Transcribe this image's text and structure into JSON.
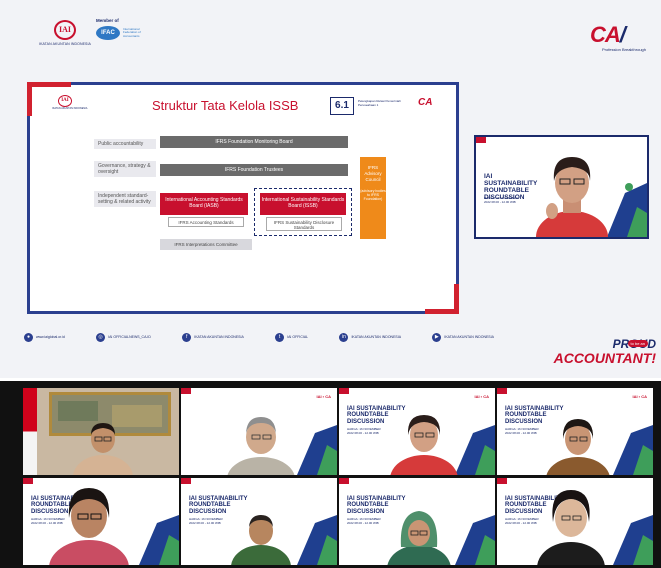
{
  "header": {
    "org_logo_text": "IKATAN AKUNTAN INDONESIA",
    "member_of": "Member of",
    "ifac": "IFAC",
    "ifac_sub": "International Federation of Accountants",
    "ca_logo": "CA",
    "ca_sub": "Profession Breakthrough"
  },
  "slide": {
    "title": "Struktur Tata Kelola ISSB",
    "number": "6.1",
    "number_caption": "Pelengkapan Relasi Pemerintah Peruseahaan 1",
    "ca_mark": "CA",
    "rows": [
      {
        "label": "Public accountability"
      },
      {
        "label": "Governance, strategy & oversight"
      },
      {
        "label": "Independent standard-setting & related activity"
      }
    ],
    "monitoring_board": "IFRS Foundation Monitoring Board",
    "trustees": "IFRS Foundation Trustees",
    "iasb": "International Accounting Standards Board (IASB)",
    "issb": "International Sustainability Standards Board (ISSB)",
    "ifrs_accounting": "IFRS Accounting Standards",
    "ifrs_sustainability": "IFRS Sustainability Disclosure Standards",
    "interpretations": "IFRS Interpretations Committee",
    "advisory": "IFRS Advisory Council",
    "advisory_note": "(advisory bodies to IFRS Foundation)"
  },
  "social": [
    {
      "icon": "globe-icon",
      "label": "www.iaiglobal.or.id"
    },
    {
      "icon": "instagram-icon",
      "label": "IAI OFFICIALNEWS_CA.ID"
    },
    {
      "icon": "facebook-icon",
      "label": "IKATAN AKUNTAN INDONESIA"
    },
    {
      "icon": "twitter-icon",
      "label": "IAI OFFICIAL"
    },
    {
      "icon": "linkedin-icon",
      "label": "IKATAN AKUNTAN INDONESIA"
    },
    {
      "icon": "youtube-icon",
      "label": "IKATAN AKUNTAN INDONESIA"
    }
  ],
  "proud": {
    "line1": "PROUD",
    "line2": "ACCOUNTANT",
    "tag": "to be an"
  },
  "event": {
    "title": "IAI SUSTAINABILITY ROUNDTABLE DISCUSSION",
    "details": "HARGA: 16 NOVEMBER 2022 08.00 - 12.00 WIB"
  },
  "colors": {
    "brand_red": "#c8102e",
    "brand_navy": "#1b2a6b",
    "advisory_orange": "#ef8a1a"
  }
}
